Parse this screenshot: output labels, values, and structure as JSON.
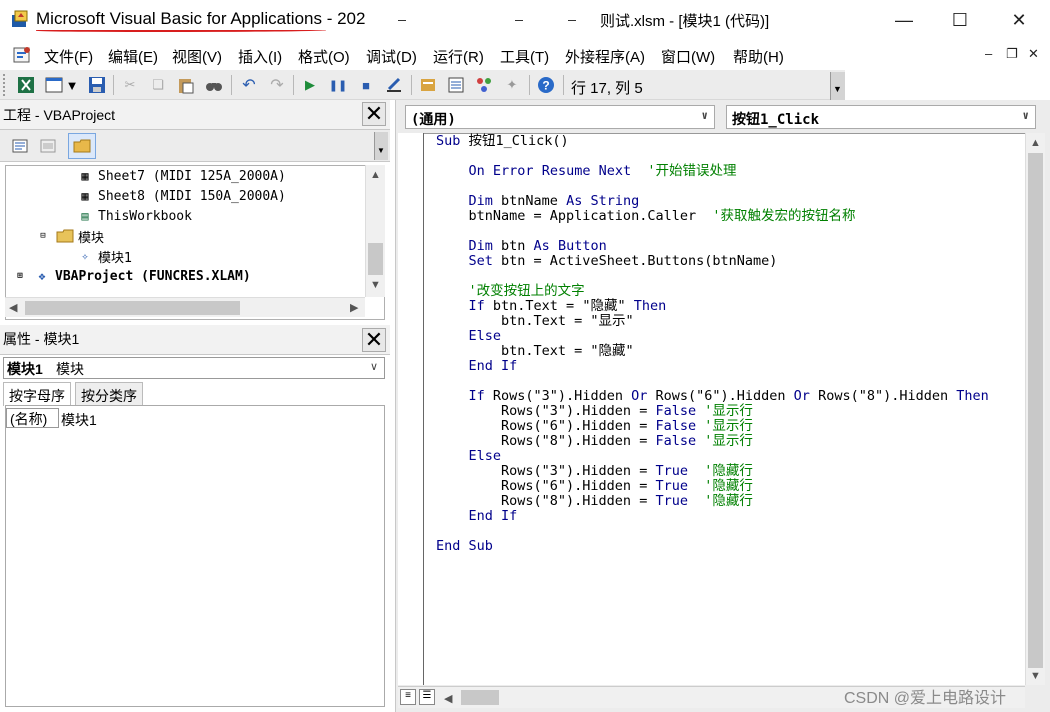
{
  "window": {
    "title": "Microsoft Visual Basic for Applications - 202",
    "file_title": "测试.xlsm - [模块1 (代码)]",
    "partial_file_title": "则试.xlsm - [模块1 (代码)]"
  },
  "menu": [
    {
      "label": "文件(F)"
    },
    {
      "label": "编辑(E)"
    },
    {
      "label": "视图(V)"
    },
    {
      "label": "插入(I)"
    },
    {
      "label": "格式(O)"
    },
    {
      "label": "调试(D)"
    },
    {
      "label": "运行(R)"
    },
    {
      "label": "工具(T)"
    },
    {
      "label": "外接程序(A)"
    },
    {
      "label": "窗口(W)"
    },
    {
      "label": "帮助(H)"
    }
  ],
  "toolbar": {
    "status": "行 17, 列 5"
  },
  "project": {
    "title": "工程 - VBAProject",
    "tree": [
      {
        "label": "Sheet7 (MIDI 125A_2000A)"
      },
      {
        "label": "Sheet8 (MIDI 150A_2000A)"
      },
      {
        "label": "ThisWorkbook"
      },
      {
        "label": "模块"
      },
      {
        "label": "模块1"
      },
      {
        "label": "VBAProject (FUNCRES.XLAM)"
      }
    ]
  },
  "properties": {
    "title": "属性 - 模块1",
    "combo_name": "模块1",
    "combo_type": "模块",
    "tab_alpha": "按字母序",
    "tab_category": "按分类序",
    "row_name": "(名称)",
    "row_value": "模块1"
  },
  "code": {
    "object_combo": "(通用)",
    "proc_combo": "按钮1_Click",
    "lines": [
      "Sub 按钮1_Click()",
      "",
      "    On Error Resume Next  '开始错误处理",
      "",
      "    Dim btnName As String",
      "    btnName = Application.Caller  '获取触发宏的按钮名称",
      "",
      "    Dim btn As Button",
      "    Set btn = ActiveSheet.Buttons(btnName)",
      "",
      "    '改变按钮上的文字",
      "    If btn.Text = \"隐藏\" Then",
      "        btn.Text = \"显示\"",
      "    Else",
      "        btn.Text = \"隐藏\"",
      "    End If",
      "",
      "    If Rows(\"3\").Hidden Or Rows(\"6\").Hidden Or Rows(\"8\").Hidden Then",
      "        Rows(\"3\").Hidden = False '显示行",
      "        Rows(\"6\").Hidden = False '显示行",
      "        Rows(\"8\").Hidden = False '显示行",
      "    Else",
      "        Rows(\"3\").Hidden = True  '隐藏行",
      "        Rows(\"6\").Hidden = True  '隐藏行",
      "        Rows(\"8\").Hidden = True  '隐藏行",
      "    End If",
      "",
      "End Sub"
    ]
  },
  "watermark": "CSDN @爱上电路设计",
  "colors": {
    "keyword": "#00008b",
    "comment": "#008000",
    "title_underline": "#d81e1e"
  }
}
